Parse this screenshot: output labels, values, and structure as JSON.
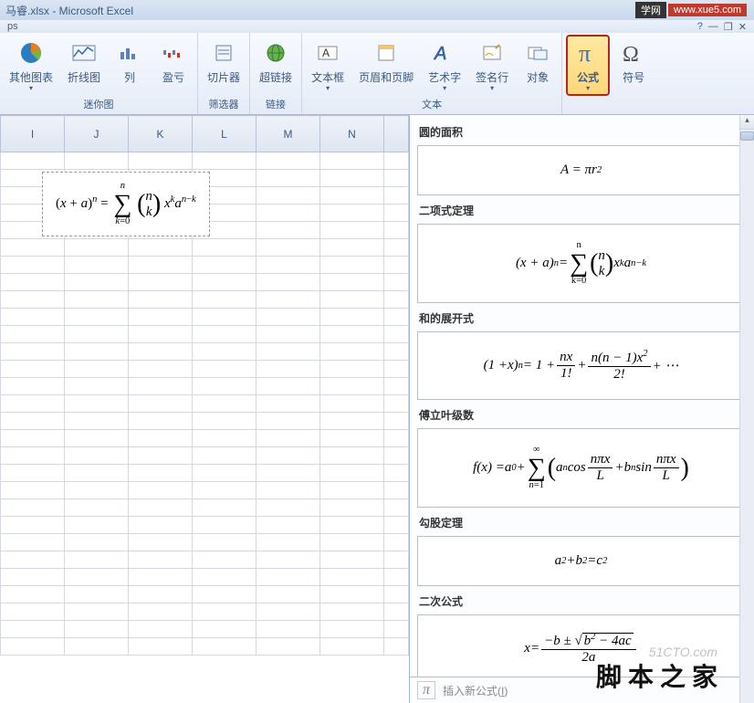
{
  "title": "马睿.xlsx - Microsoft Excel",
  "badges": {
    "left": "学网",
    "right": "www.xue5.com"
  },
  "qat": {
    "label": "ps"
  },
  "window_controls": {
    "help": "?",
    "minimize": "—",
    "restore": "❐",
    "close": "✕"
  },
  "ribbon": {
    "groups": {
      "sparklines": {
        "label": "迷你图",
        "buttons": {
          "other": "其他图表",
          "line": "折线图",
          "column": "列",
          "winloss": "盈亏"
        }
      },
      "filters": {
        "label": "筛选器",
        "buttons": {
          "slicer": "切片器"
        }
      },
      "links": {
        "label": "链接",
        "buttons": {
          "hyperlink": "超链接"
        }
      },
      "text": {
        "label": "文本",
        "buttons": {
          "textbox": "文本框",
          "headerfooter": "页眉和页脚",
          "wordart": "艺术字",
          "signature": "签名行",
          "object": "对象"
        }
      },
      "symbols": {
        "label": "",
        "buttons": {
          "equation": "公式",
          "symbol": "符号"
        }
      }
    }
  },
  "columns": [
    "I",
    "J",
    "K",
    "L",
    "M",
    "N"
  ],
  "cell_formula": "(x + a)ⁿ = Σ C(n,k) xᵏ aⁿ⁻ᵏ",
  "panel": {
    "circle_area": {
      "title": "圆的面积",
      "formula": "A = πr²"
    },
    "binomial": {
      "title": "二项式定理",
      "formula": "(x + a)ⁿ = Σ_{k=0}^{n} C(n,k) xᵏ aⁿ⁻ᵏ"
    },
    "expansion": {
      "title": "和的展开式",
      "formula": "(1 + x)ⁿ = 1 + nx/1! + n(n−1)x²/2! + ⋯"
    },
    "fourier": {
      "title": "傅立叶级数",
      "formula": "f(x) = a₀ + Σ_{n=1}^{∞} (aₙ cos(nπx/L) + bₙ sin(nπx/L))"
    },
    "pythagoras": {
      "title": "勾股定理",
      "formula": "a² + b² = c²"
    },
    "quadratic": {
      "title": "二次公式",
      "formula": "x = (−b ± √(b² − 4ac)) / 2a"
    }
  },
  "footer": {
    "icon": "π",
    "placeholder": "插入新公式"
  },
  "watermarks": {
    "main": "脚 本 之 家",
    "faint": "51CTO.com"
  }
}
